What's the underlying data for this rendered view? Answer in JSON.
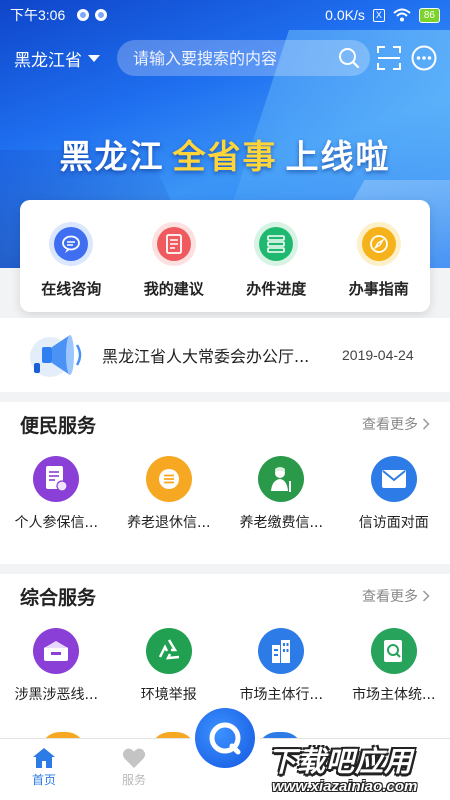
{
  "status_bar": {
    "time": "下午3:06",
    "network_speed": "0.0K/s",
    "battery": "86",
    "x_badge": "X"
  },
  "header": {
    "region": "黑龙江省",
    "search_placeholder": "请输入要搜索的内容"
  },
  "banner": {
    "part1": "黑龙江",
    "part2": "全省事",
    "part3": "上线啦"
  },
  "quick_actions": [
    {
      "label": "在线咨询",
      "icon": "chat-bubble-icon",
      "color": "#3f6ff0"
    },
    {
      "label": "我的建议",
      "icon": "document-icon",
      "color": "#ef5a5e"
    },
    {
      "label": "办件进度",
      "icon": "progress-list-icon",
      "color": "#1fb86f"
    },
    {
      "label": "办事指南",
      "icon": "compass-icon",
      "color": "#f5b21a"
    }
  ],
  "news": {
    "title": "黑龙江省人大常委会办公厅...",
    "date": "2019-04-24"
  },
  "sections": {
    "convenience": {
      "title": "便民服务",
      "more": "查看更多",
      "items": [
        {
          "label": "个人参保信...",
          "icon": "insurance-document-icon",
          "color": "#8a3fd6"
        },
        {
          "label": "养老退休信...",
          "icon": "list-icon",
          "color": "#f7a823"
        },
        {
          "label": "养老缴费信...",
          "icon": "elderly-person-icon",
          "color": "#2a9a4a"
        },
        {
          "label": "信访面对面",
          "icon": "envelope-icon",
          "color": "#2d7be6"
        }
      ]
    },
    "comprehensive": {
      "title": "综合服务",
      "more": "查看更多",
      "items": [
        {
          "label": "涉黑涉恶线...",
          "icon": "report-box-icon",
          "color": "#8a3fd6"
        },
        {
          "label": "环境举报",
          "icon": "recycle-icon",
          "color": "#20a050"
        },
        {
          "label": "市场主体行...",
          "icon": "building-icon",
          "color": "#2d7be6"
        },
        {
          "label": "市场主体统...",
          "icon": "search-document-icon",
          "color": "#27a35b"
        }
      ]
    }
  },
  "tabbar": {
    "home": "首页",
    "service": "服务"
  },
  "watermark": {
    "main": "下载吧应用",
    "url": "www.xiazainiao.com"
  },
  "colors": {
    "brand_blue": "#1f6ff0",
    "gold": "#ffd53a",
    "tab_active": "#2d7be6",
    "tab_inactive": "#b8b8b8"
  }
}
